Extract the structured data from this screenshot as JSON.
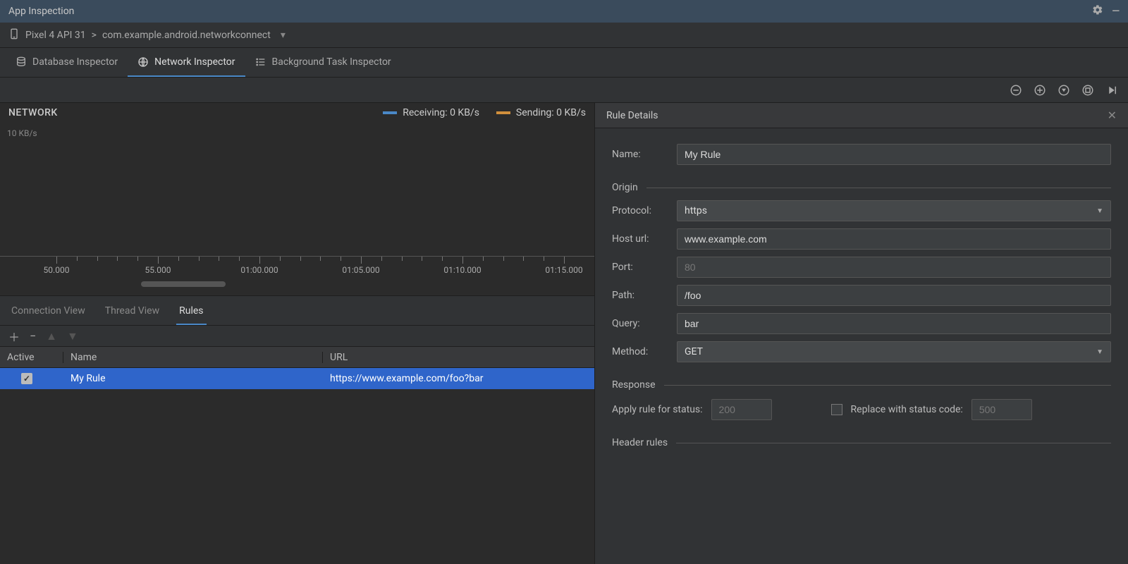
{
  "titlebar": {
    "title": "App Inspection"
  },
  "breadcrumb": {
    "device": "Pixel 4 API 31",
    "sep": ">",
    "process": "com.example.android.networkconnect"
  },
  "tabs": {
    "db": "Database Inspector",
    "net": "Network Inspector",
    "bg": "Background Task Inspector"
  },
  "chart": {
    "title": "NETWORK",
    "y_label": "10 KB/s",
    "legend_recv": "Receiving: 0 KB/s",
    "legend_send": "Sending: 0 KB/s"
  },
  "chart_data": {
    "type": "line",
    "series": [
      {
        "name": "Receiving",
        "values": [],
        "unit": "KB/s",
        "current": 0,
        "color": "#4a88c7"
      },
      {
        "name": "Sending",
        "values": [],
        "unit": "KB/s",
        "current": 0,
        "color": "#d08f3c"
      }
    ],
    "x_ticks": [
      "50.000",
      "55.000",
      "01:00.000",
      "01:05.000",
      "01:10.000",
      "01:15.000"
    ],
    "y_ticks": [
      "10 KB/s"
    ],
    "ylim": [
      0,
      10
    ]
  },
  "sub_tabs": {
    "conn": "Connection View",
    "thread": "Thread View",
    "rules": "Rules"
  },
  "rules_table": {
    "headers": {
      "active": "Active",
      "name": "Name",
      "url": "URL"
    },
    "rows": [
      {
        "active": true,
        "name": "My Rule",
        "url": "https://www.example.com/foo?bar"
      }
    ]
  },
  "details": {
    "title": "Rule Details",
    "name_label": "Name:",
    "name_value": "My Rule",
    "origin_section": "Origin",
    "protocol_label": "Protocol:",
    "protocol_value": "https",
    "host_label": "Host url:",
    "host_value": "www.example.com",
    "port_label": "Port:",
    "port_placeholder": "80",
    "path_label": "Path:",
    "path_value": "/foo",
    "query_label": "Query:",
    "query_value": "bar",
    "method_label": "Method:",
    "method_value": "GET",
    "response_section": "Response",
    "apply_status_label": "Apply rule for status:",
    "apply_status_placeholder": "200",
    "replace_label": "Replace with status code:",
    "replace_placeholder": "500",
    "header_rules_section": "Header rules"
  }
}
